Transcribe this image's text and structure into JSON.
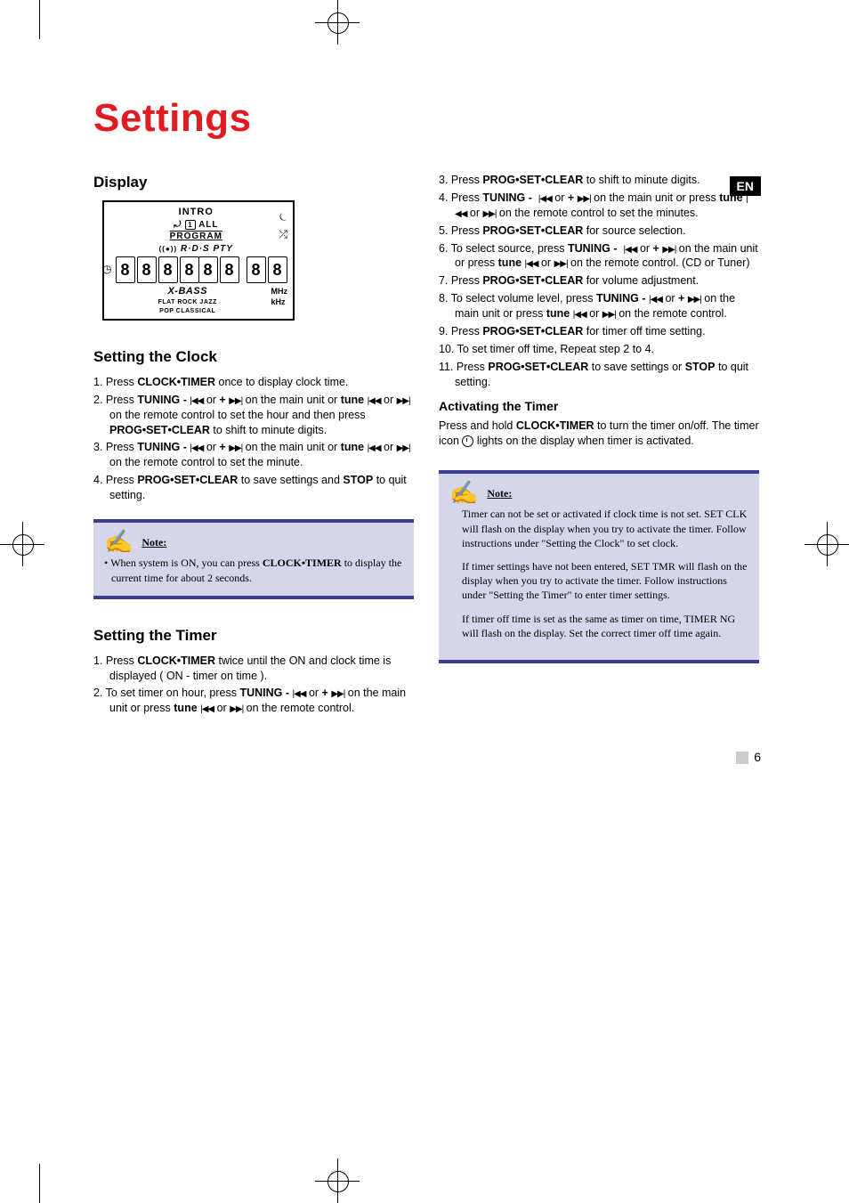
{
  "title": "Settings",
  "lang_badge": "EN",
  "page_number": "6",
  "left": {
    "display_heading": "Display",
    "display_panel": {
      "intro": "INTRO",
      "row2_left": "⟳",
      "row2_mid": "ALL",
      "row2_prog": "PROGRAM",
      "rds": "R·D·S",
      "pty": "PTY",
      "segments": [
        "8",
        "8",
        "8",
        "8",
        "8",
        "8",
        "8",
        "8"
      ],
      "xbass": "X-BASS",
      "mhz": "MHz",
      "khz": "kHz",
      "eq_line1": "FLAT   ROCK   JAZZ",
      "eq_line2": "POP   CLASSICAL"
    },
    "clock_heading": "Setting the Clock",
    "clock_steps": [
      {
        "n": "1.",
        "html": "Press <b>CLOCK•TIMER</b> once to display clock time."
      },
      {
        "n": "2.",
        "html": "Press <b>TUNING -</b> <span class='iconbtn'>|◀◀</span> or <b>+</b> <span class='iconbtn'>▶▶|</span> on the main unit or <b>tune</b> <span class='iconbtn'>|◀◀</span> or <span class='iconbtn'>▶▶|</span> on the remote control to set the hour and then press <b>PROG•SET•CLEAR</b> to shift to minute digits."
      },
      {
        "n": "3.",
        "html": "Press <b>TUNING -</b> <span class='iconbtn'>|◀◀</span> or <b>+</b> <span class='iconbtn'>▶▶|</span> on the main unit or <b>tune</b> <span class='iconbtn'>|◀◀</span> or <span class='iconbtn'>▶▶|</span> on the remote control to set the minute."
      },
      {
        "n": "4.",
        "html": "Press <b>PROG•SET•CLEAR</b> to save settings and <b>STOP</b> to quit setting."
      }
    ],
    "note_title": "Note:",
    "note_body": "When system is ON, you can press <b>CLOCK•TIMER</b> to display the current time for about 2 seconds.",
    "timer_heading": "Setting the Timer",
    "timer_steps_left": [
      {
        "n": "1.",
        "html": "Press <b>CLOCK•TIMER</b> twice until the ON and clock time is displayed ( ON  - timer on time )."
      },
      {
        "n": "2.",
        "html": "To set timer on hour, press <b>TUNING -</b> <span class='iconbtn'>|◀◀</span> or <b>+</b> <span class='iconbtn'>▶▶|</span> on the main unit or press <b>tune</b> <span class='iconbtn'>|◀◀</span> or <span class='iconbtn'>▶▶|</span> on the remote control."
      }
    ]
  },
  "right": {
    "timer_steps_right": [
      {
        "n": "3.",
        "html": "Press <b>PROG•SET•CLEAR</b> to shift to minute digits."
      },
      {
        "n": "4.",
        "html": "Press <b>TUNING -</b> &nbsp;<span class='iconbtn'>|◀◀</span> or <b>+</b> <span class='iconbtn'>▶▶|</span> on the main unit or press <b>tune</b> <span class='iconbtn'>|◀◀</span> or <span class='iconbtn'>▶▶|</span> on the remote control to set the minutes."
      },
      {
        "n": "5.",
        "html": "Press <b>PROG•SET•CLEAR</b> for source selection."
      },
      {
        "n": "6.",
        "html": "To select source, press <b>TUNING -</b> &nbsp;<span class='iconbtn'>|◀◀</span> or <b>+</b> <span class='iconbtn'>▶▶|</span> on the main unit or press <b>tune</b> <span class='iconbtn'>|◀◀</span> or <span class='iconbtn'>▶▶|</span> on the remote control. (CD or Tuner)"
      },
      {
        "n": "7.",
        "html": "Press <b>PROG•SET•CLEAR</b> for volume adjustment."
      },
      {
        "n": "8.",
        "html": "To select volume level, press <b>TUNING -</b> <span class='iconbtn'>|◀◀</span> or <b>+</b> <span class='iconbtn'>▶▶|</span> on the main unit or press <b>tune</b> <span class='iconbtn'>|◀◀</span> or <span class='iconbtn'>▶▶|</span> on the remote control."
      },
      {
        "n": "9.",
        "html": "Press <b>PROG•SET•CLEAR</b> for timer off time setting."
      },
      {
        "n": "10.",
        "html": "To set timer off time, Repeat step 2 to 4."
      },
      {
        "n": "11.",
        "html": "Press <b>PROG•SET•CLEAR</b> to save settings or <b>STOP</b> to quit setting."
      }
    ],
    "activate_heading": "Activating the Timer",
    "activate_body": "Press and hold <b>CLOCK•TIMER</b> to turn the timer on/off. The timer icon <span class='timer-icon'></span> lights on the display when timer is activated.",
    "note_title": "Note:",
    "note_paras": [
      "Timer can not be set or activated if clock time is not set. SET CLK will flash on the display when you try to activate the timer. Follow instructions under \"Setting the Clock\" to set clock.",
      "If timer settings have not been entered, SET TMR will flash on the display when you try to activate the timer.  Follow instructions under \"Setting the Timer\" to enter timer settings.",
      "If timer off time is set as the same as timer on time, TIMER NG will flash on the display.  Set the correct timer off time again."
    ]
  }
}
